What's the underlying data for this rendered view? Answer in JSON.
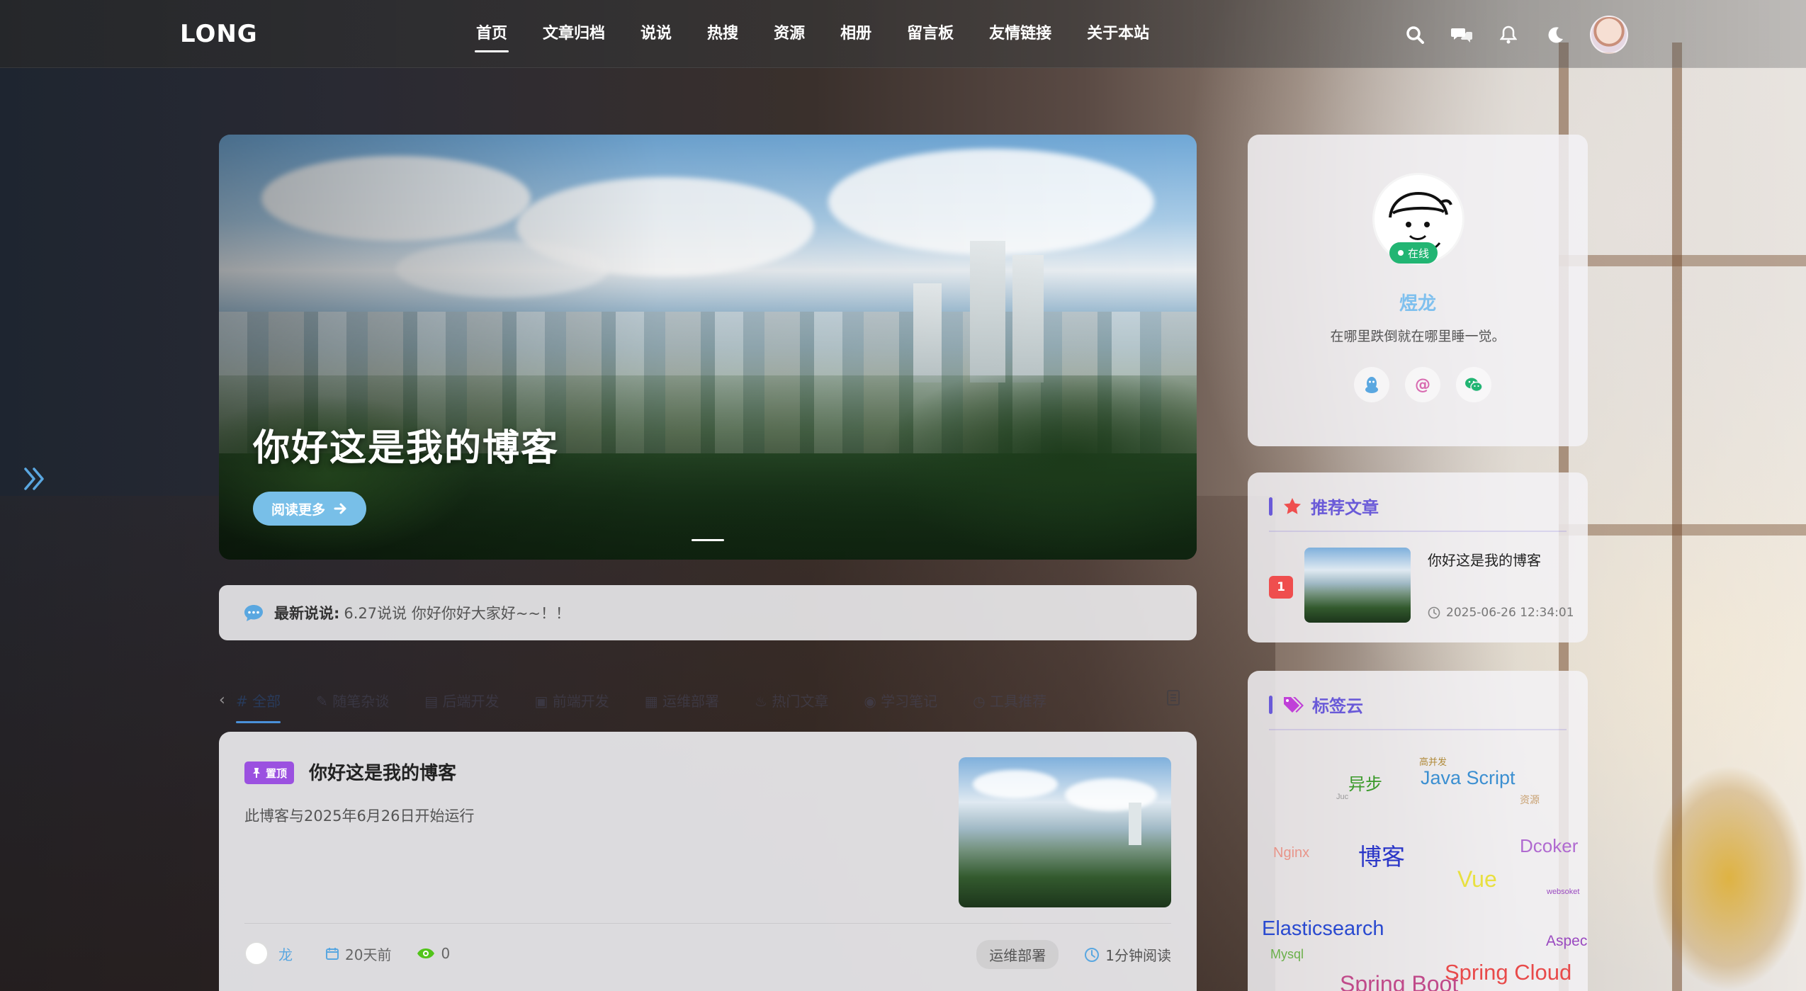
{
  "nav": {
    "logo": "LONG",
    "items": [
      "首页",
      "文章归档",
      "说说",
      "热搜",
      "资源",
      "相册",
      "留言板",
      "友情链接",
      "关于本站"
    ]
  },
  "hero": {
    "title": "你好这是我的博客",
    "button": "阅读更多"
  },
  "latest": {
    "label": "最新说说:",
    "text": "6.27说说 你好你好大家好~~！！"
  },
  "categories": [
    "# 全部",
    "✎ 随笔杂谈",
    "▤ 后端开发",
    "▣ 前端开发",
    "▦ 运维部署",
    "♨ 热门文章",
    "◉ 学习笔记",
    "◷ 工具推荐"
  ],
  "article": {
    "badge": "置顶",
    "title": "你好这是我的博客",
    "excerpt": "此博客与2025年6月26日开始运行",
    "author": "龙",
    "time": "20天前",
    "views": "0",
    "tag": "运维部署",
    "read_time": "1分钟阅读"
  },
  "profile": {
    "name": "煜龙",
    "bio": "在哪里跌倒就在哪里睡一觉。",
    "status": "在线"
  },
  "recommend": {
    "heading": "推荐文章",
    "items": [
      {
        "rank": "1",
        "title": "你好这是我的博客",
        "date": "2025-06-26 12:34:01"
      }
    ]
  },
  "tagcloud": {
    "heading": "标签云",
    "tags": [
      {
        "text": "高并发",
        "color": "#b08a3a"
      },
      {
        "text": "异步",
        "color": "#3a9a2a"
      },
      {
        "text": "Java Script",
        "color": "#3b8fd1"
      },
      {
        "text": "Juc",
        "color": "#999999"
      },
      {
        "text": "资源",
        "color": "#c8a070"
      },
      {
        "text": "Nginx",
        "color": "#e8958a"
      },
      {
        "text": "博客",
        "color": "#2a36c8"
      },
      {
        "text": "Dcoker",
        "color": "#b06ad0"
      },
      {
        "text": "Vue",
        "color": "#e8e040"
      },
      {
        "text": "websoket",
        "color": "#9a4ac0"
      },
      {
        "text": "Elasticsearch",
        "color": "#2a4ad0"
      },
      {
        "text": "Mysql",
        "color": "#6ab04a"
      },
      {
        "text": "Aspec",
        "color": "#9a4ac0"
      },
      {
        "text": "Spring Boot",
        "color": "#c04a8a"
      },
      {
        "text": "Spring Cloud",
        "color": "#e84a4a"
      }
    ]
  }
}
